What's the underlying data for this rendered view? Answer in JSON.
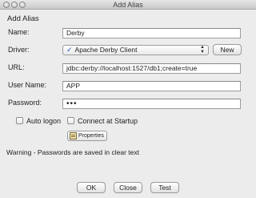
{
  "window": {
    "title": "Add Alias"
  },
  "dialog": {
    "heading": "Add Alias"
  },
  "form": {
    "name_label": "Name:",
    "name_value": "Derby",
    "driver_label": "Driver:",
    "driver_value": "Apache Derby Client",
    "new_button": "New",
    "url_label": "URL:",
    "url_value": "jdbc:derby://localhost:1527/db1;create=true",
    "username_label": "User Name:",
    "username_value": "APP",
    "password_label": "Password:",
    "password_value": "•••"
  },
  "options": {
    "auto_logon": "Auto logon",
    "connect_at_startup": "Connect at Startup",
    "properties_button": "Properties"
  },
  "warning": "Warning - Passwords are saved in clear text",
  "buttons": {
    "ok": "OK",
    "close": "Close",
    "test": "Test"
  }
}
